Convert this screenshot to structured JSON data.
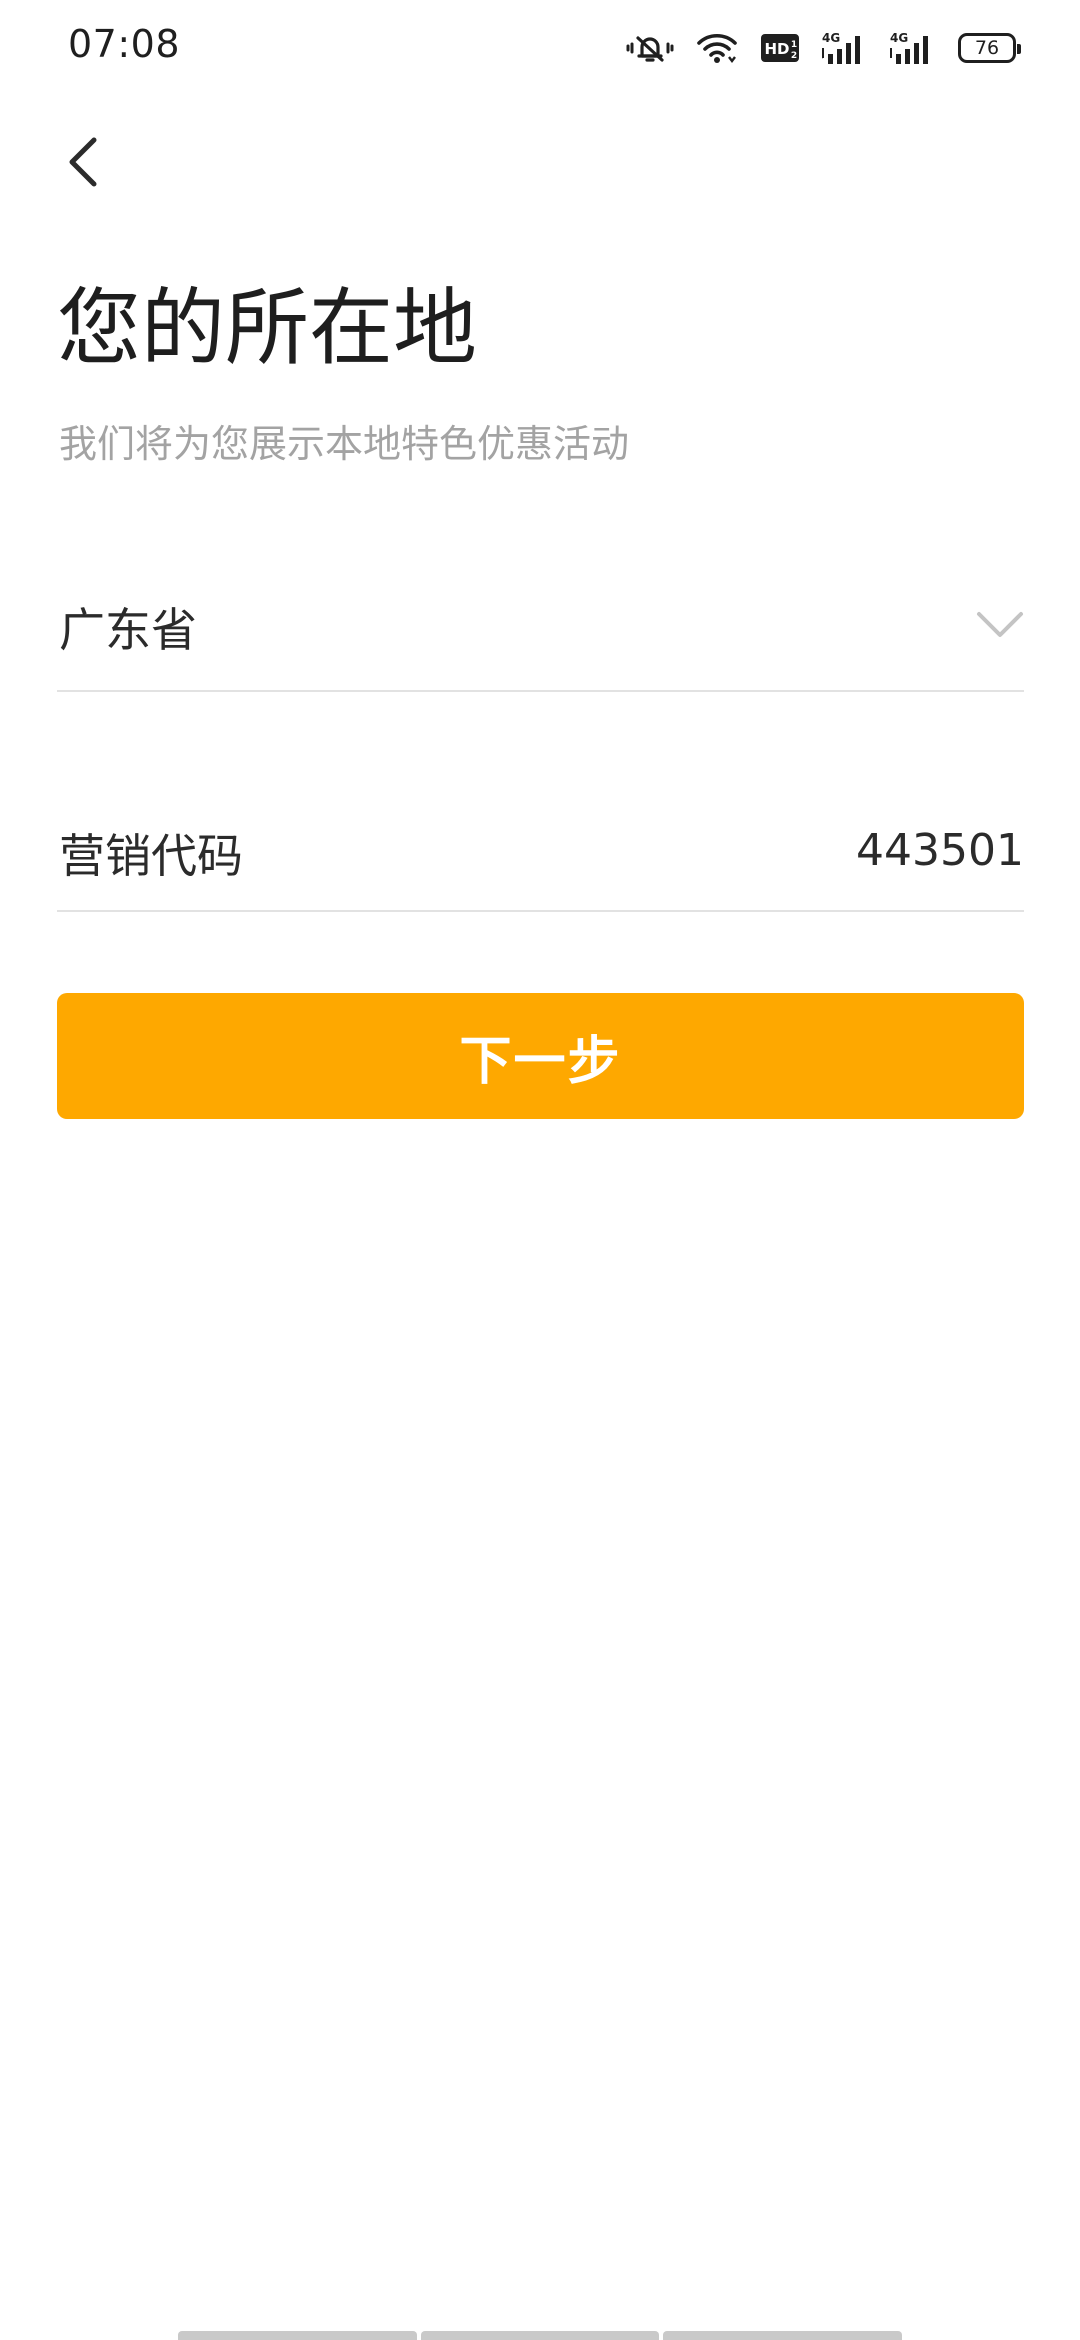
{
  "status_bar": {
    "time": "07:08",
    "network_1": "4G",
    "network_2": "4G",
    "hd_label": "HD",
    "battery_level": "76",
    "icons": [
      "mute-bell-icon",
      "wifi-icon",
      "hd-voice-icon",
      "signal-4g-icon",
      "signal-4g-icon",
      "battery-icon"
    ]
  },
  "header": {
    "back_icon": "chevron-left-icon"
  },
  "main": {
    "title": "您的所在地",
    "subtitle": "我们将为您展示本地特色优惠活动",
    "province": {
      "value": "广东省",
      "icon": "chevron-down-icon"
    },
    "marketing_code": {
      "label": "营销代码",
      "value": "443501"
    },
    "next_button_label": "下一步"
  },
  "colors": {
    "accent": "#fea800",
    "text_primary": "#2b2b2b",
    "text_secondary": "#a3a3a3",
    "divider": "#e2e2e2"
  }
}
